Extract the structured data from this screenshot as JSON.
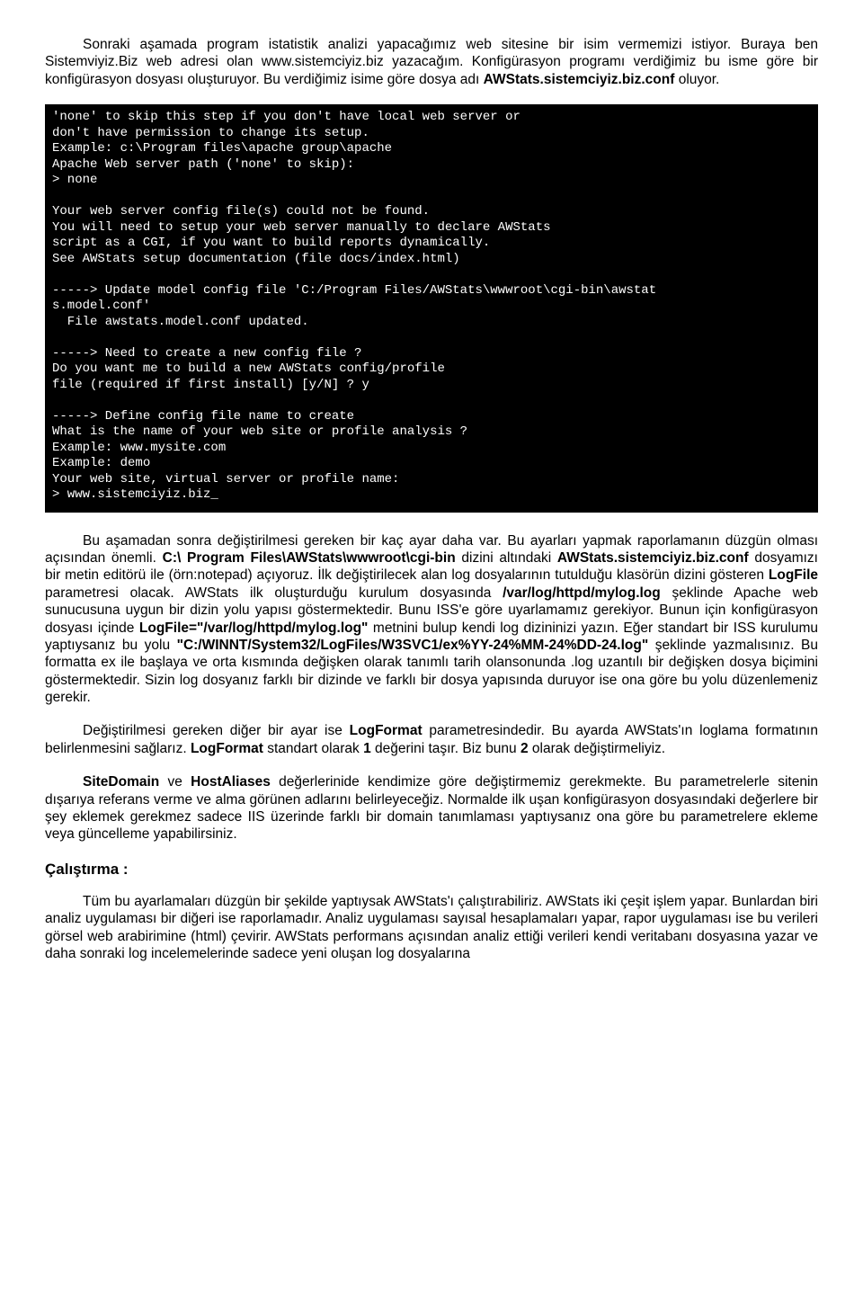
{
  "p1_a": "Sonraki aşamada program istatistik analizi yapacağımız web sitesine bir isim vermemizi istiyor. Buraya ben Sistemviyiz.Biz web adresi olan www.sistemciyiz.biz yazacağım. Konfigürasyon programı verdiğimiz bu isme göre bir konfigürasyon dosyası oluşturuyor. Bu verdiğimiz isime göre dosya adı ",
  "p1_b": "AWStats.sistemciyiz.biz.conf",
  "p1_c": " oluyor.",
  "term": "'none' to skip this step if you don't have local web server or\ndon't have permission to change its setup.\nExample: c:\\Program files\\apache group\\apache\nApache Web server path ('none' to skip):\n> none\n\nYour web server config file(s) could not be found.\nYou will need to setup your web server manually to declare AWStats\nscript as a CGI, if you want to build reports dynamically.\nSee AWStats setup documentation (file docs/index.html)\n\n-----> Update model config file 'C:/Program Files/AWStats\\wwwroot\\cgi-bin\\awstat\ns.model.conf'\n  File awstats.model.conf updated.\n\n-----> Need to create a new config file ?\nDo you want me to build a new AWStats config/profile\nfile (required if first install) [y/N] ? y\n\n-----> Define config file name to create\nWhat is the name of your web site or profile analysis ?\nExample: www.mysite.com\nExample: demo\nYour web site, virtual server or profile name:\n> www.sistemciyiz.biz_",
  "p2_a": "Bu aşamadan sonra değiştirilmesi gereken bir kaç ayar daha var. Bu ayarları yapmak raporlamanın düzgün olması açısından önemli. ",
  "p2_b": "C:\\ Program Files\\AWStats\\wwwroot\\cgi-bin",
  "p2_c": " dizini altındaki ",
  "p2_d": "AWStats.sistemciyiz.biz.conf",
  "p2_e": " dosyamızı bir metin editörü ile (örn:notepad) açıyoruz. İlk değiştirilecek alan log dosyalarının tutulduğu klasörün dizini gösteren ",
  "p2_f": "LogFile",
  "p2_g": " parametresi olacak. AWStats ilk oluşturduğu kurulum dosyasında ",
  "p2_h": "/var/log/httpd/mylog.log",
  "p2_i": " şeklinde Apache web sunucusuna uygun bir dizin yolu yapısı göstermektedir. Bunu ISS'e göre uyarlamamız gerekiyor. Bunun için konfigürasyon dosyası içinde ",
  "p2_j": "LogFile=\"/var/log/httpd/mylog.log\"",
  "p2_k": " metnini bulup kendi log dizininizi yazın. Eğer standart bir ISS kurulumu yaptıysanız bu yolu ",
  "p2_l": "\"C:/WINNT/System32/LogFiles/W3SVC1/ex%YY-24%MM-24%DD-24.log\"",
  "p2_m": " şeklinde yazmalısınız. Bu formatta ex ile başlaya ve orta kısmında değişken olarak tanımlı tarih olansonunda .log uzantılı bir değişken dosya biçimini göstermektedir. Sizin log dosyanız farklı bir dizinde ve farklı bir dosya yapısında duruyor ise ona göre bu yolu düzenlemeniz gerekir.",
  "p3_a": "Değiştirilmesi gereken diğer bir ayar ise ",
  "p3_b": "LogFormat",
  "p3_c": " parametresindedir. Bu ayarda AWStats'ın loglama formatının belirlenmesini sağlarız. ",
  "p3_d": "LogFormat",
  "p3_e": " standart olarak ",
  "p3_f": "1",
  "p3_g": " değerini taşır. Biz bunu ",
  "p3_h": "2",
  "p3_i": " olarak değiştirmeliyiz.",
  "p4_a": "SiteDomain",
  "p4_b": " ve ",
  "p4_c": "HostAliases",
  "p4_d": " değerlerinide kendimize göre değiştirmemiz gerekmekte. Bu parametrelerle sitenin dışarıya referans verme ve alma görünen adlarını belirleyeceğiz. Normalde ilk uşan konfigürasyon dosyasındaki değerlere bir şey eklemek gerekmez sadece IIS üzerinde farklı bir domain tanımlaması yaptıysanız ona göre bu parametrelere ekleme veya güncelleme yapabilirsiniz.",
  "h1": "Çalıştırma :",
  "p5": "Tüm bu ayarlamaları düzgün bir şekilde yaptıysak AWStats'ı çalıştırabiliriz. AWStats iki çeşit işlem yapar. Bunlardan biri analiz uygulaması bir diğeri ise raporlamadır. Analiz uygulaması sayısal hesaplamaları yapar, rapor uygulaması ise bu verileri görsel web arabirimine (html) çevirir. AWStats performans açısından analiz ettiği verileri kendi veritabanı dosyasına yazar ve daha sonraki log incelemelerinde sadece yeni oluşan log dosyalarına"
}
